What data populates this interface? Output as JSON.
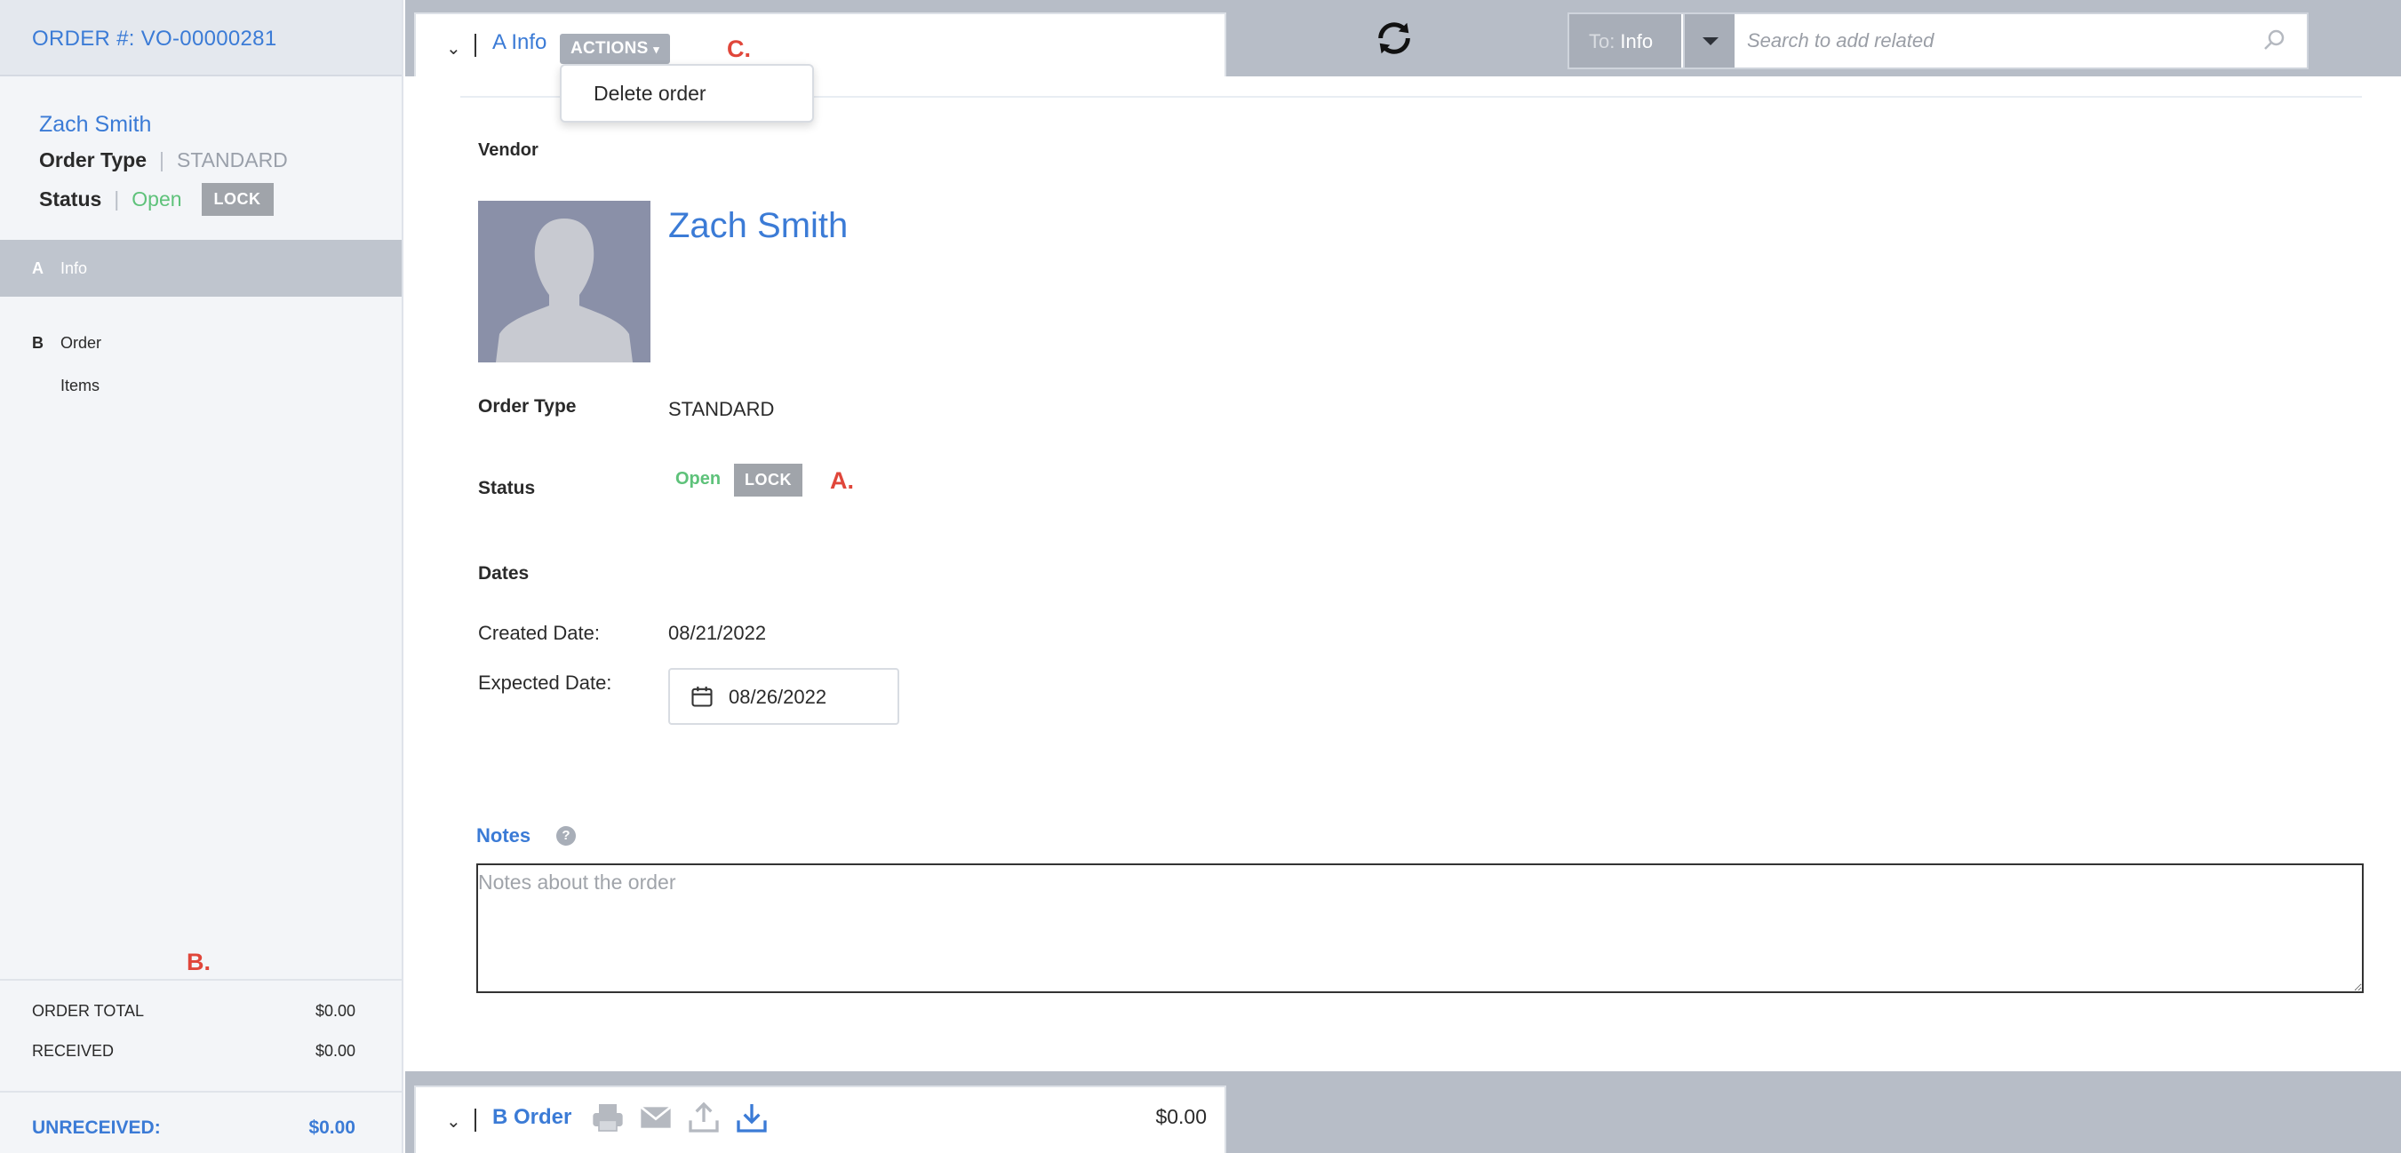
{
  "sidebar": {
    "order_number": "ORDER #: VO-00000281",
    "vendor_name": "Zach Smith",
    "order_type_label": "Order Type",
    "order_type_value": "STANDARD",
    "status_label": "Status",
    "status_value": "Open",
    "lock_label": "LOCK",
    "nav": [
      {
        "key": "A",
        "label": "Info"
      },
      {
        "key": "B",
        "label": "Order"
      },
      {
        "key": "",
        "label": "Items"
      }
    ],
    "totals": {
      "order_total_label": "ORDER TOTAL",
      "order_total_value": "$0.00",
      "received_label": "RECEIVED",
      "received_value": "$0.00",
      "unreceived_label": "UNRECEIVED:",
      "unreceived_value": "$0.00"
    }
  },
  "annotations": {
    "a": "A.",
    "b": "B.",
    "c": "C."
  },
  "topbar": {
    "tab_title": "A Info",
    "actions_label": "ACTIONS",
    "search_scope_prefix": "To:",
    "search_scope_value": "Info",
    "search_placeholder": "Search to add related"
  },
  "dropdown": {
    "items": [
      "Delete order"
    ]
  },
  "main": {
    "vendor_label": "Vendor",
    "vendor_name": "Zach Smith",
    "order_type_label": "Order Type",
    "order_type_value": "STANDARD",
    "status_label": "Status",
    "status_value": "Open",
    "lock_label": "LOCK",
    "dates_label": "Dates",
    "created_label": "Created Date:",
    "created_value": "08/21/2022",
    "expected_label": "Expected Date:",
    "expected_value": "08/26/2022",
    "notes_label": "Notes",
    "help_glyph": "?",
    "notes_placeholder": "Notes about the order"
  },
  "bottombar": {
    "tab_title": "B Order",
    "amount": "$0.00",
    "icons": [
      "print-icon",
      "email-icon",
      "upload-icon",
      "download-icon"
    ]
  },
  "colors": {
    "accent": "#3b7bd6",
    "status_open": "#5ec27a",
    "annotation": "#e0463a",
    "chrome": "#b7bdc7"
  }
}
